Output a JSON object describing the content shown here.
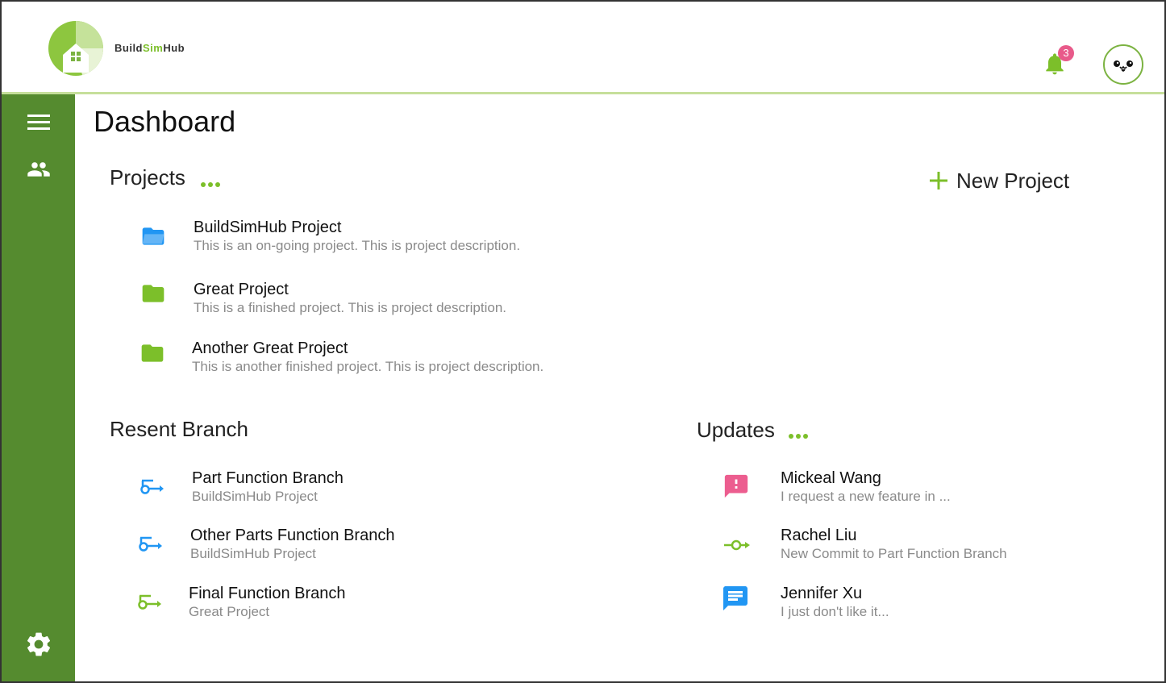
{
  "brand": {
    "name_prefix": "Build",
    "name_accent": "Sim",
    "name_suffix": "Hub",
    "color_primary": "#558b2f",
    "color_accent": "#7cbf2a"
  },
  "header": {
    "notification_icon": "bell-icon",
    "notification_count": "3",
    "avatar_icon": "kawaii-face-avatar"
  },
  "sidebar": {
    "items": [
      {
        "icon": "menu-icon"
      },
      {
        "icon": "people-icon"
      },
      {
        "icon": "gear-icon"
      }
    ]
  },
  "page": {
    "title": "Dashboard"
  },
  "projects": {
    "section_title": "Projects",
    "new_project_label": "New Project",
    "items": [
      {
        "title": "BuildSimHub Project",
        "description": "This is an on-going project. This is project description.",
        "icon": "folder-open-icon"
      },
      {
        "title": "Great Project",
        "description": "This is a finished project. This is project description.",
        "icon": "folder-icon"
      },
      {
        "title": "Another Great Project",
        "description": "This is another finished project. This is project description.",
        "icon": "folder-icon"
      }
    ]
  },
  "branches": {
    "section_title": "Resent Branch",
    "items": [
      {
        "title": "Part Function Branch",
        "project": "BuildSimHub Project",
        "icon": "branch-icon"
      },
      {
        "title": "Other Parts Function Branch",
        "project": "BuildSimHub Project",
        "icon": "branch-icon"
      },
      {
        "title": "Final Function Branch",
        "project": "Great Project",
        "icon": "branch-icon"
      }
    ]
  },
  "updates": {
    "section_title": "Updates",
    "items": [
      {
        "name": "Mickeal Wang",
        "message": "I request a new feature in ...",
        "icon": "feedback-icon"
      },
      {
        "name": "Rachel Liu",
        "message": "New Commit to Part Function Branch",
        "icon": "commit-icon"
      },
      {
        "name": "Jennifer Xu",
        "message": "I just don't like it...",
        "icon": "comment-icon"
      }
    ]
  }
}
